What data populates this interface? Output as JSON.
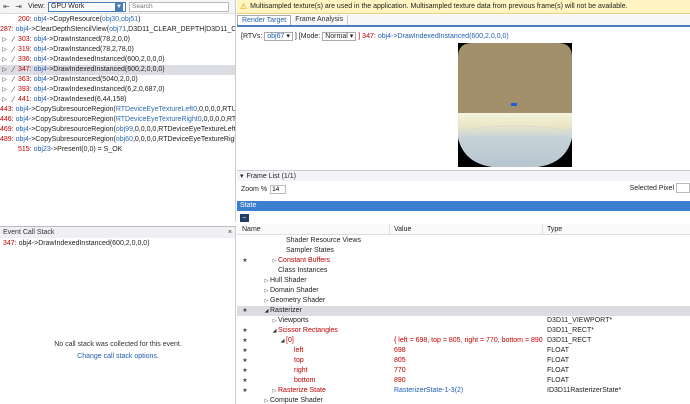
{
  "toolbar": {
    "view_label": "View:",
    "view_value": "GPU Work",
    "search_placeholder": "Search"
  },
  "events": [
    {
      "num": "200:",
      "obj": "obj4",
      "call": "->CopyResource(",
      "args": "obj30,obj51",
      "tail": ")",
      "brush": false,
      "expand": false
    },
    {
      "num": "287:",
      "obj": "obj4",
      "call": "->ClearDepthStencilView(",
      "args": "obj71",
      "tail": ",D3D11_CLEAR_DEPTH|D3D11_CLEA",
      "brush": false,
      "expand": false
    },
    {
      "num": "303:",
      "obj": "obj4",
      "call": "->DrawInstanced(78,2,0,0)",
      "args": "",
      "tail": "",
      "brush": true,
      "expand": true
    },
    {
      "num": "319:",
      "obj": "obj4",
      "call": "->DrawInstanced(78,2,78,0)",
      "args": "",
      "tail": "",
      "brush": true,
      "expand": true
    },
    {
      "num": "336:",
      "obj": "obj4",
      "call": "->DrawIndexedInstanced(600,2,0,0,0)",
      "args": "",
      "tail": "",
      "brush": true,
      "expand": true
    },
    {
      "num": "347:",
      "obj": "obj4",
      "call": "->DrawIndexedInstanced(600,2,0,0,0)",
      "args": "",
      "tail": "",
      "brush": true,
      "expand": true,
      "selected": true
    },
    {
      "num": "363:",
      "obj": "obj4",
      "call": "->DrawInstanced(5040,2,0,0)",
      "args": "",
      "tail": "",
      "brush": true,
      "expand": true
    },
    {
      "num": "393:",
      "obj": "obj4",
      "call": "->DrawIndexedInstanced(6,2,0,687,0)",
      "args": "",
      "tail": "",
      "brush": true,
      "expand": true
    },
    {
      "num": "441:",
      "obj": "obj4",
      "call": "->DrawIndexed(6,44,158)",
      "args": "",
      "tail": "",
      "brush": true,
      "expand": true
    },
    {
      "num": "443:",
      "obj": "obj4",
      "call": "->CopySubresourceRegion(",
      "args": "RTDeviceEyeTextureLeft0",
      "tail": ",0,0,0,0,RTUnity",
      "brush": false,
      "expand": false
    },
    {
      "num": "446:",
      "obj": "obj4",
      "call": "->CopySubresourceRegion(",
      "args": "RTDeviceEyeTextureRight0",
      "tail": ",0,0,0,0,RTUni",
      "brush": false,
      "expand": false
    },
    {
      "num": "469:",
      "obj": "obj4",
      "call": "->CopySubresourceRegion(",
      "args": "obj99",
      "tail": ",0,0,0,0,RTDeviceEyeTextureLeft0,",
      "brush": false,
      "expand": false
    },
    {
      "num": "489:",
      "obj": "obj4",
      "call": "->CopySubresourceRegion(",
      "args": "obj60",
      "tail": ",0,0,0,0,RTDeviceEyeTextureRight0",
      "brush": false,
      "expand": false
    },
    {
      "num": "515:",
      "obj": "obj23",
      "call": "->Present(0,0) = S_OK",
      "args": "",
      "tail": "",
      "brush": false,
      "expand": false
    }
  ],
  "callstack": {
    "title": "Event Call Stack",
    "entry_num": "347:",
    "entry_text": "obj4->DrawIndexedInstanced(600,2,0,0,0)",
    "no_stack_msg": "No call stack was collected for this event.",
    "options_link": "Change call stack options."
  },
  "warning": "Multisampled texture(s) are used in the application. Multisampled texture data from previous frame(s) will not be available.",
  "tabs": [
    {
      "label": "Render Target",
      "active": true
    },
    {
      "label": "Frame Analysis",
      "active": false
    }
  ],
  "rtv": {
    "prefix": "[RTVs:",
    "rtv_value": "obj67",
    "mid": "] [Mode:",
    "mode_value": "Normal",
    "suffix_num": "] 347:",
    "suffix_text": "obj4->DrawIndexedInstanced(600,2,0,0,0)"
  },
  "framelist": {
    "label": "Frame List (1/1)"
  },
  "zoom": {
    "label": "Zoom %",
    "value": "14",
    "selected_pixel_label": "Selected Pixel"
  },
  "state": {
    "header": "State",
    "columns": {
      "name": "Name",
      "value": "Value",
      "type": "Type"
    },
    "rows": [
      {
        "star": "",
        "indent": 2,
        "arrow": "",
        "name": "Shader Resource Views",
        "red": false,
        "value": "",
        "type": ""
      },
      {
        "star": "",
        "indent": 2,
        "arrow": "",
        "name": "Sampler States",
        "red": false,
        "value": "",
        "type": ""
      },
      {
        "star": "★",
        "indent": 1,
        "arrow": "▷",
        "name": "Constant Buffers",
        "red": true,
        "value": "",
        "type": ""
      },
      {
        "star": "",
        "indent": 1,
        "arrow": "",
        "name": "Class Instances",
        "red": false,
        "value": "",
        "type": ""
      },
      {
        "star": "",
        "indent": 0,
        "arrow": "▷",
        "name": "Hull Shader",
        "red": false,
        "value": "",
        "type": ""
      },
      {
        "star": "",
        "indent": 0,
        "arrow": "▷",
        "name": "Domain Shader",
        "red": false,
        "value": "",
        "type": ""
      },
      {
        "star": "",
        "indent": 0,
        "arrow": "▷",
        "name": "Geometry Shader",
        "red": false,
        "value": "",
        "type": ""
      },
      {
        "star": "★",
        "indent": 0,
        "arrow": "◢",
        "name": "Rasterizer",
        "red": false,
        "value": "",
        "type": "",
        "highlight": true
      },
      {
        "star": "",
        "indent": 1,
        "arrow": "▷",
        "name": "Viewports",
        "red": false,
        "value": "",
        "type": "D3D11_VIEWPORT*"
      },
      {
        "star": "★",
        "indent": 1,
        "arrow": "◢",
        "name": "Scissor Rectangles",
        "red": true,
        "value": "",
        "type": "D3D11_RECT*"
      },
      {
        "star": "★",
        "indent": 2,
        "arrow": "◢",
        "name": "[0]",
        "red": true,
        "value": "{ left = 698, top = 805, right = 770, bottom = 890 }",
        "value_red": true,
        "type": "D3D11_RECT"
      },
      {
        "star": "★",
        "indent": 3,
        "arrow": "",
        "name": "left",
        "red": true,
        "value": "698",
        "value_red": true,
        "type": "FLOAT"
      },
      {
        "star": "★",
        "indent": 3,
        "arrow": "",
        "name": "top",
        "red": true,
        "value": "805",
        "value_red": true,
        "type": "FLOAT"
      },
      {
        "star": "★",
        "indent": 3,
        "arrow": "",
        "name": "right",
        "red": true,
        "value": "770",
        "value_red": true,
        "type": "FLOAT"
      },
      {
        "star": "★",
        "indent": 3,
        "arrow": "",
        "name": "bottom",
        "red": true,
        "value": "890",
        "value_red": true,
        "type": "FLOAT"
      },
      {
        "star": "★",
        "indent": 1,
        "arrow": "▷",
        "name": "Rasterize State",
        "red": true,
        "value": "RasterizerState-1-3(2)",
        "value_blue": true,
        "type": "ID3D11RasterizerState*"
      },
      {
        "star": "",
        "indent": 0,
        "arrow": "▷",
        "name": "Compute Shader",
        "red": false,
        "value": "",
        "type": ""
      },
      {
        "star": "",
        "indent": 0,
        "arrow": "▷",
        "name": "Pixel Shader",
        "red": false,
        "value": "",
        "type": ""
      }
    ]
  },
  "colors": {
    "accent": "#3c7fd1",
    "error_red": "#c00000",
    "link_blue": "#1f5fb4",
    "warning_bg": "#fff4c2",
    "render_sky": "#a28f6c",
    "render_horizon": "#f4f2d8",
    "render_floor": "#b9c8d2"
  }
}
